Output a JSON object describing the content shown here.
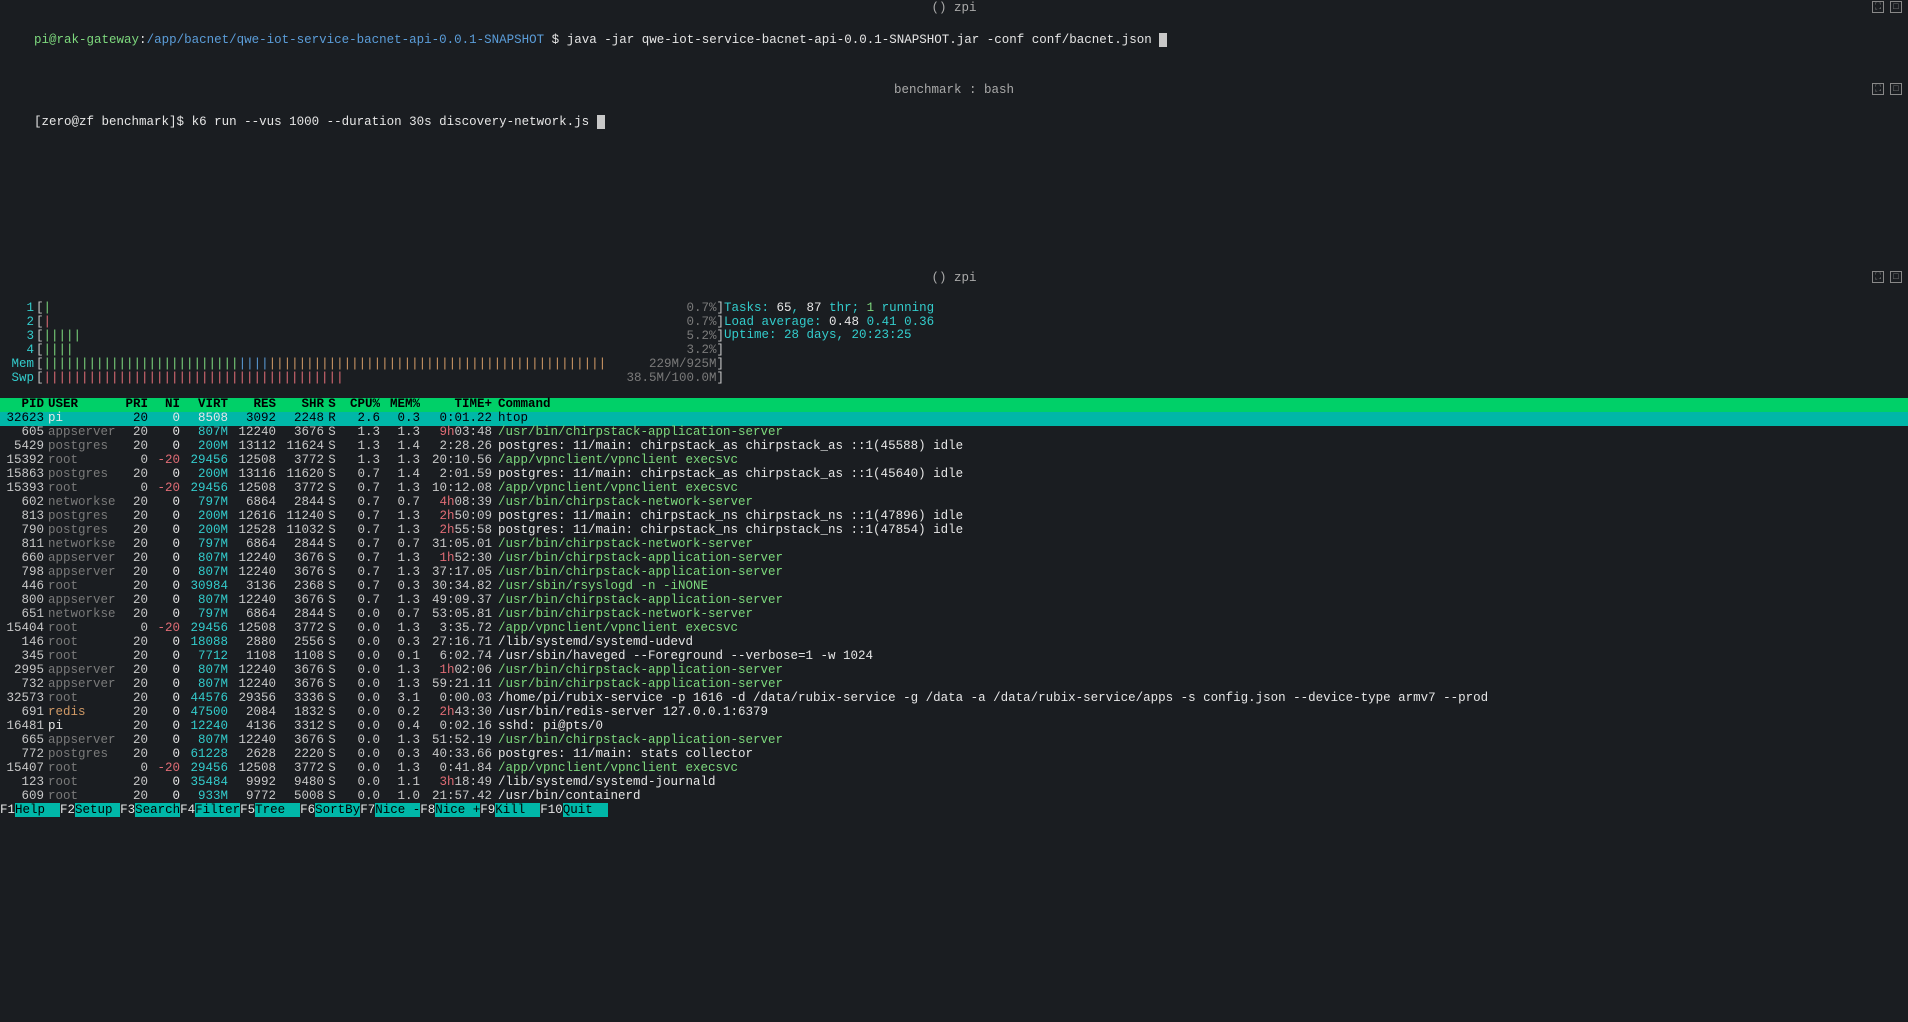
{
  "pane1": {
    "title": "() zpi",
    "user": "pi@rak-gateway",
    "cwd": "/app/bacnet/qwe-iot-service-bacnet-api-0.0.1-SNAPSHOT",
    "prompt": "$",
    "command": "java -jar qwe-iot-service-bacnet-api-0.0.1-SNAPSHOT.jar -conf conf/bacnet.json"
  },
  "pane2": {
    "title": "benchmark : bash",
    "prefix": "[zero@zf benchmark]$",
    "command": "k6 run --vus 1000 --duration 30s discovery-network.js"
  },
  "pane3": {
    "title": "() zpi",
    "cpus": [
      {
        "n": "1",
        "bar": "|",
        "color": "#7dd87d",
        "pct": "0.7%"
      },
      {
        "n": "2",
        "bar": "|",
        "color": "#e06c75",
        "pct": "0.7%"
      },
      {
        "n": "3",
        "bar": "|||||",
        "color": "#7dd87d",
        "pct": "5.2%"
      },
      {
        "n": "4",
        "bar": "||||",
        "color": "#7dd87d",
        "pct": "3.2%"
      }
    ],
    "mem": {
      "label": "Mem",
      "pct": "229M/925M"
    },
    "swp": {
      "label": "Swp",
      "pct": "38.5M/100.0M"
    },
    "tasks": {
      "total": "65",
      "threads": "87",
      "running": "1"
    },
    "load": [
      "0.48",
      "0.41",
      "0.36"
    ],
    "uptime": "28 days, 20:23:25",
    "header": [
      "PID",
      "USER",
      "PRI",
      "NI",
      "VIRT",
      "RES",
      "SHR",
      "S",
      "CPU%",
      "MEM%",
      "TIME+",
      "Command"
    ],
    "processes": [
      {
        "pid": "32623",
        "user": "pi",
        "uc": "w",
        "pri": "20",
        "ni": "0",
        "nic": "w",
        "virt": "8508",
        "vc": "w",
        "res": "3092",
        "shr": "2248",
        "s": "R",
        "cpu": "2.6",
        "mem": "0.3",
        "time": "0:01.22",
        "tc": "",
        "cmd": "htop",
        "cc": "",
        "hilite": true
      },
      {
        "pid": "605",
        "user": "appserver",
        "uc": "d",
        "pri": "20",
        "ni": "0",
        "nic": "w",
        "virt": "807M",
        "vc": "c",
        "res": "12240",
        "shr": "3676",
        "s": "S",
        "cpu": "1.3",
        "mem": "1.3",
        "time": "9h03:48",
        "tc": "r",
        "cmd": "/usr/bin/chirpstack-application-server",
        "cc": "g"
      },
      {
        "pid": "5429",
        "user": "postgres",
        "uc": "d",
        "pri": "20",
        "ni": "0",
        "nic": "w",
        "virt": "200M",
        "vc": "c",
        "res": "13112",
        "shr": "11624",
        "s": "S",
        "cpu": "1.3",
        "mem": "1.4",
        "time": "2:28.26",
        "tc": "",
        "cmd": "postgres: 11/main: chirpstack_as chirpstack_as ::1(45588) idle",
        "cc": "w"
      },
      {
        "pid": "15392",
        "user": "root",
        "uc": "d",
        "pri": "0",
        "ni": "-20",
        "nic": "r",
        "virt": "29456",
        "vc": "c",
        "res": "12508",
        "shr": "3772",
        "s": "S",
        "cpu": "1.3",
        "mem": "1.3",
        "time": "20:10.56",
        "tc": "",
        "cmd": "/app/vpnclient/vpnclient execsvc",
        "cc": "g"
      },
      {
        "pid": "15863",
        "user": "postgres",
        "uc": "d",
        "pri": "20",
        "ni": "0",
        "nic": "w",
        "virt": "200M",
        "vc": "c",
        "res": "13116",
        "shr": "11620",
        "s": "S",
        "cpu": "0.7",
        "mem": "1.4",
        "time": "2:01.59",
        "tc": "",
        "cmd": "postgres: 11/main: chirpstack_as chirpstack_as ::1(45640) idle",
        "cc": "w"
      },
      {
        "pid": "15393",
        "user": "root",
        "uc": "d",
        "pri": "0",
        "ni": "-20",
        "nic": "r",
        "virt": "29456",
        "vc": "c",
        "res": "12508",
        "shr": "3772",
        "s": "S",
        "cpu": "0.7",
        "mem": "1.3",
        "time": "10:12.08",
        "tc": "",
        "cmd": "/app/vpnclient/vpnclient execsvc",
        "cc": "g"
      },
      {
        "pid": "602",
        "user": "networkse",
        "uc": "d",
        "pri": "20",
        "ni": "0",
        "nic": "w",
        "virt": "797M",
        "vc": "c",
        "res": "6864",
        "shr": "2844",
        "s": "S",
        "cpu": "0.7",
        "mem": "0.7",
        "time": "4h08:39",
        "tc": "r",
        "cmd": "/usr/bin/chirpstack-network-server",
        "cc": "g"
      },
      {
        "pid": "813",
        "user": "postgres",
        "uc": "d",
        "pri": "20",
        "ni": "0",
        "nic": "w",
        "virt": "200M",
        "vc": "c",
        "res": "12616",
        "shr": "11240",
        "s": "S",
        "cpu": "0.7",
        "mem": "1.3",
        "time": "2h50:09",
        "tc": "r",
        "cmd": "postgres: 11/main: chirpstack_ns chirpstack_ns ::1(47896) idle",
        "cc": "w"
      },
      {
        "pid": "790",
        "user": "postgres",
        "uc": "d",
        "pri": "20",
        "ni": "0",
        "nic": "w",
        "virt": "200M",
        "vc": "c",
        "res": "12528",
        "shr": "11032",
        "s": "S",
        "cpu": "0.7",
        "mem": "1.3",
        "time": "2h55:58",
        "tc": "r",
        "cmd": "postgres: 11/main: chirpstack_ns chirpstack_ns ::1(47854) idle",
        "cc": "w"
      },
      {
        "pid": "811",
        "user": "networkse",
        "uc": "d",
        "pri": "20",
        "ni": "0",
        "nic": "w",
        "virt": "797M",
        "vc": "c",
        "res": "6864",
        "shr": "2844",
        "s": "S",
        "cpu": "0.7",
        "mem": "0.7",
        "time": "31:05.01",
        "tc": "",
        "cmd": "/usr/bin/chirpstack-network-server",
        "cc": "g"
      },
      {
        "pid": "660",
        "user": "appserver",
        "uc": "d",
        "pri": "20",
        "ni": "0",
        "nic": "w",
        "virt": "807M",
        "vc": "c",
        "res": "12240",
        "shr": "3676",
        "s": "S",
        "cpu": "0.7",
        "mem": "1.3",
        "time": "1h52:30",
        "tc": "r",
        "cmd": "/usr/bin/chirpstack-application-server",
        "cc": "g"
      },
      {
        "pid": "798",
        "user": "appserver",
        "uc": "d",
        "pri": "20",
        "ni": "0",
        "nic": "w",
        "virt": "807M",
        "vc": "c",
        "res": "12240",
        "shr": "3676",
        "s": "S",
        "cpu": "0.7",
        "mem": "1.3",
        "time": "37:17.05",
        "tc": "",
        "cmd": "/usr/bin/chirpstack-application-server",
        "cc": "g"
      },
      {
        "pid": "446",
        "user": "root",
        "uc": "d",
        "pri": "20",
        "ni": "0",
        "nic": "w",
        "virt": "30984",
        "vc": "c",
        "res": "3136",
        "shr": "2368",
        "s": "S",
        "cpu": "0.7",
        "mem": "0.3",
        "time": "30:34.82",
        "tc": "",
        "cmd": "/usr/sbin/rsyslogd -n -iNONE",
        "cc": "g"
      },
      {
        "pid": "800",
        "user": "appserver",
        "uc": "d",
        "pri": "20",
        "ni": "0",
        "nic": "w",
        "virt": "807M",
        "vc": "c",
        "res": "12240",
        "shr": "3676",
        "s": "S",
        "cpu": "0.7",
        "mem": "1.3",
        "time": "49:09.37",
        "tc": "",
        "cmd": "/usr/bin/chirpstack-application-server",
        "cc": "g"
      },
      {
        "pid": "651",
        "user": "networkse",
        "uc": "d",
        "pri": "20",
        "ni": "0",
        "nic": "w",
        "virt": "797M",
        "vc": "c",
        "res": "6864",
        "shr": "2844",
        "s": "S",
        "cpu": "0.0",
        "mem": "0.7",
        "time": "53:05.81",
        "tc": "",
        "cmd": "/usr/bin/chirpstack-network-server",
        "cc": "g"
      },
      {
        "pid": "15404",
        "user": "root",
        "uc": "d",
        "pri": "0",
        "ni": "-20",
        "nic": "r",
        "virt": "29456",
        "vc": "c",
        "res": "12508",
        "shr": "3772",
        "s": "S",
        "cpu": "0.0",
        "mem": "1.3",
        "time": "3:35.72",
        "tc": "",
        "cmd": "/app/vpnclient/vpnclient execsvc",
        "cc": "g"
      },
      {
        "pid": "146",
        "user": "root",
        "uc": "d",
        "pri": "20",
        "ni": "0",
        "nic": "w",
        "virt": "18088",
        "vc": "c",
        "res": "2880",
        "shr": "2556",
        "s": "S",
        "cpu": "0.0",
        "mem": "0.3",
        "time": "27:16.71",
        "tc": "",
        "cmd": "/lib/systemd/systemd-udevd",
        "cc": "w"
      },
      {
        "pid": "345",
        "user": "root",
        "uc": "d",
        "pri": "20",
        "ni": "0",
        "nic": "w",
        "virt": "7712",
        "vc": "c",
        "res": "1108",
        "shr": "1108",
        "s": "S",
        "cpu": "0.0",
        "mem": "0.1",
        "time": "6:02.74",
        "tc": "",
        "cmd": "/usr/sbin/haveged --Foreground --verbose=1 -w 1024",
        "cc": "w"
      },
      {
        "pid": "2995",
        "user": "appserver",
        "uc": "d",
        "pri": "20",
        "ni": "0",
        "nic": "w",
        "virt": "807M",
        "vc": "c",
        "res": "12240",
        "shr": "3676",
        "s": "S",
        "cpu": "0.0",
        "mem": "1.3",
        "time": "1h02:06",
        "tc": "r",
        "cmd": "/usr/bin/chirpstack-application-server",
        "cc": "g"
      },
      {
        "pid": "732",
        "user": "appserver",
        "uc": "d",
        "pri": "20",
        "ni": "0",
        "nic": "w",
        "virt": "807M",
        "vc": "c",
        "res": "12240",
        "shr": "3676",
        "s": "S",
        "cpu": "0.0",
        "mem": "1.3",
        "time": "59:21.11",
        "tc": "",
        "cmd": "/usr/bin/chirpstack-application-server",
        "cc": "g"
      },
      {
        "pid": "32573",
        "user": "root",
        "uc": "d",
        "pri": "20",
        "ni": "0",
        "nic": "w",
        "virt": "44576",
        "vc": "c",
        "res": "29356",
        "shr": "3336",
        "s": "S",
        "cpu": "0.0",
        "mem": "3.1",
        "time": "0:00.03",
        "tc": "",
        "cmd": "/home/pi/rubix-service -p 1616 -d /data/rubix-service -g /data -a /data/rubix-service/apps -s config.json --device-type armv7 --prod",
        "cc": "w"
      },
      {
        "pid": "691",
        "user": "redis",
        "uc": "o",
        "pri": "20",
        "ni": "0",
        "nic": "w",
        "virt": "47500",
        "vc": "c",
        "res": "2084",
        "shr": "1832",
        "s": "S",
        "cpu": "0.0",
        "mem": "0.2",
        "time": "2h43:30",
        "tc": "r",
        "cmd": "/usr/bin/redis-server 127.0.0.1:6379",
        "cc": "w"
      },
      {
        "pid": "16481",
        "user": "pi",
        "uc": "w",
        "pri": "20",
        "ni": "0",
        "nic": "w",
        "virt": "12240",
        "vc": "c",
        "res": "4136",
        "shr": "3312",
        "s": "S",
        "cpu": "0.0",
        "mem": "0.4",
        "time": "0:02.16",
        "tc": "",
        "cmd": "sshd: pi@pts/0",
        "cc": "w"
      },
      {
        "pid": "665",
        "user": "appserver",
        "uc": "d",
        "pri": "20",
        "ni": "0",
        "nic": "w",
        "virt": "807M",
        "vc": "c",
        "res": "12240",
        "shr": "3676",
        "s": "S",
        "cpu": "0.0",
        "mem": "1.3",
        "time": "51:52.19",
        "tc": "",
        "cmd": "/usr/bin/chirpstack-application-server",
        "cc": "g"
      },
      {
        "pid": "772",
        "user": "postgres",
        "uc": "d",
        "pri": "20",
        "ni": "0",
        "nic": "w",
        "virt": "61228",
        "vc": "c",
        "res": "2628",
        "shr": "2220",
        "s": "S",
        "cpu": "0.0",
        "mem": "0.3",
        "time": "40:33.66",
        "tc": "",
        "cmd": "postgres: 11/main: stats collector",
        "cc": "w"
      },
      {
        "pid": "15407",
        "user": "root",
        "uc": "d",
        "pri": "0",
        "ni": "-20",
        "nic": "r",
        "virt": "29456",
        "vc": "c",
        "res": "12508",
        "shr": "3772",
        "s": "S",
        "cpu": "0.0",
        "mem": "1.3",
        "time": "0:41.84",
        "tc": "",
        "cmd": "/app/vpnclient/vpnclient execsvc",
        "cc": "g"
      },
      {
        "pid": "123",
        "user": "root",
        "uc": "d",
        "pri": "20",
        "ni": "0",
        "nic": "w",
        "virt": "35484",
        "vc": "c",
        "res": "9992",
        "shr": "9480",
        "s": "S",
        "cpu": "0.0",
        "mem": "1.1",
        "time": "3h18:49",
        "tc": "r",
        "cmd": "/lib/systemd/systemd-journald",
        "cc": "w"
      },
      {
        "pid": "609",
        "user": "root",
        "uc": "d",
        "pri": "20",
        "ni": "0",
        "nic": "w",
        "virt": "933M",
        "vc": "c",
        "res": "9772",
        "shr": "5008",
        "s": "S",
        "cpu": "0.0",
        "mem": "1.0",
        "time": "21:57.42",
        "tc": "",
        "cmd": "/usr/bin/containerd",
        "cc": "w"
      }
    ],
    "footer": [
      {
        "k": "F1",
        "l": "Help"
      },
      {
        "k": "F2",
        "l": "Setup"
      },
      {
        "k": "F3",
        "l": "Search"
      },
      {
        "k": "F4",
        "l": "Filter"
      },
      {
        "k": "F5",
        "l": "Tree"
      },
      {
        "k": "F6",
        "l": "SortBy"
      },
      {
        "k": "F7",
        "l": "Nice -"
      },
      {
        "k": "F8",
        "l": "Nice +"
      },
      {
        "k": "F9",
        "l": "Kill"
      },
      {
        "k": "F10",
        "l": "Quit"
      }
    ]
  }
}
